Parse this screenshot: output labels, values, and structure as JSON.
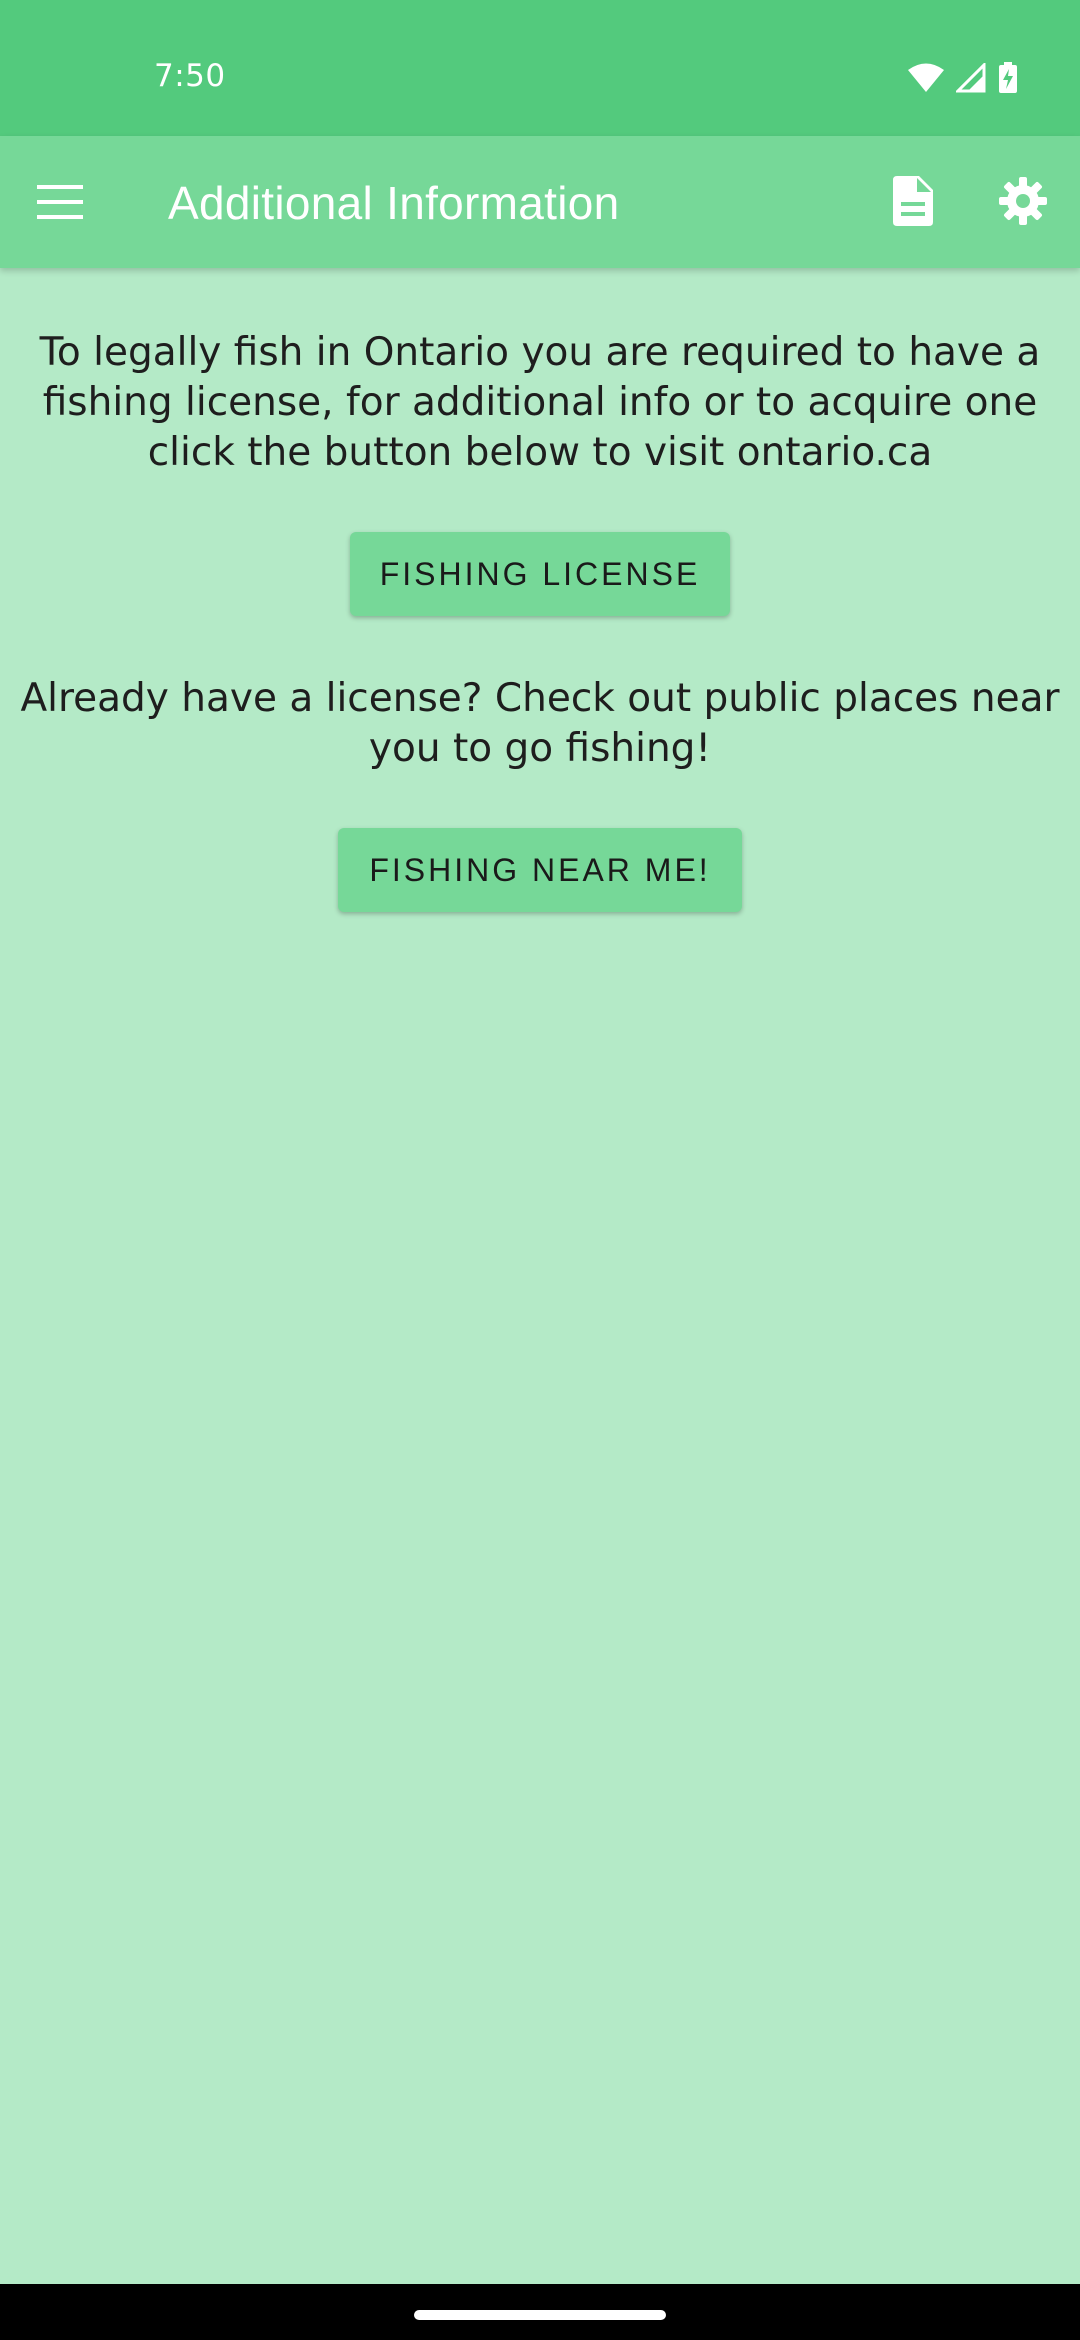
{
  "status_bar": {
    "time": "7:50",
    "icons": [
      "wifi-icon",
      "cell-signal-icon",
      "battery-charging-icon"
    ]
  },
  "app_bar": {
    "title": "Additional Information",
    "icons": [
      "menu-icon",
      "document-icon",
      "gear-icon"
    ],
    "color": "#76d898"
  },
  "content": {
    "license_info": "To legally fish in Ontario you are required to have a fishing license, for additional info or to acquire one click the button below to visit ontario.ca",
    "license_button": "FISHING LICENSE",
    "places_info": "Already have a license? Check out public places near you to go fishing!",
    "near_me_button": "FISHING NEAR ME!"
  },
  "colors": {
    "status_bar": "#53ca7d",
    "background": "#b4eac7",
    "button": "#76d898"
  }
}
